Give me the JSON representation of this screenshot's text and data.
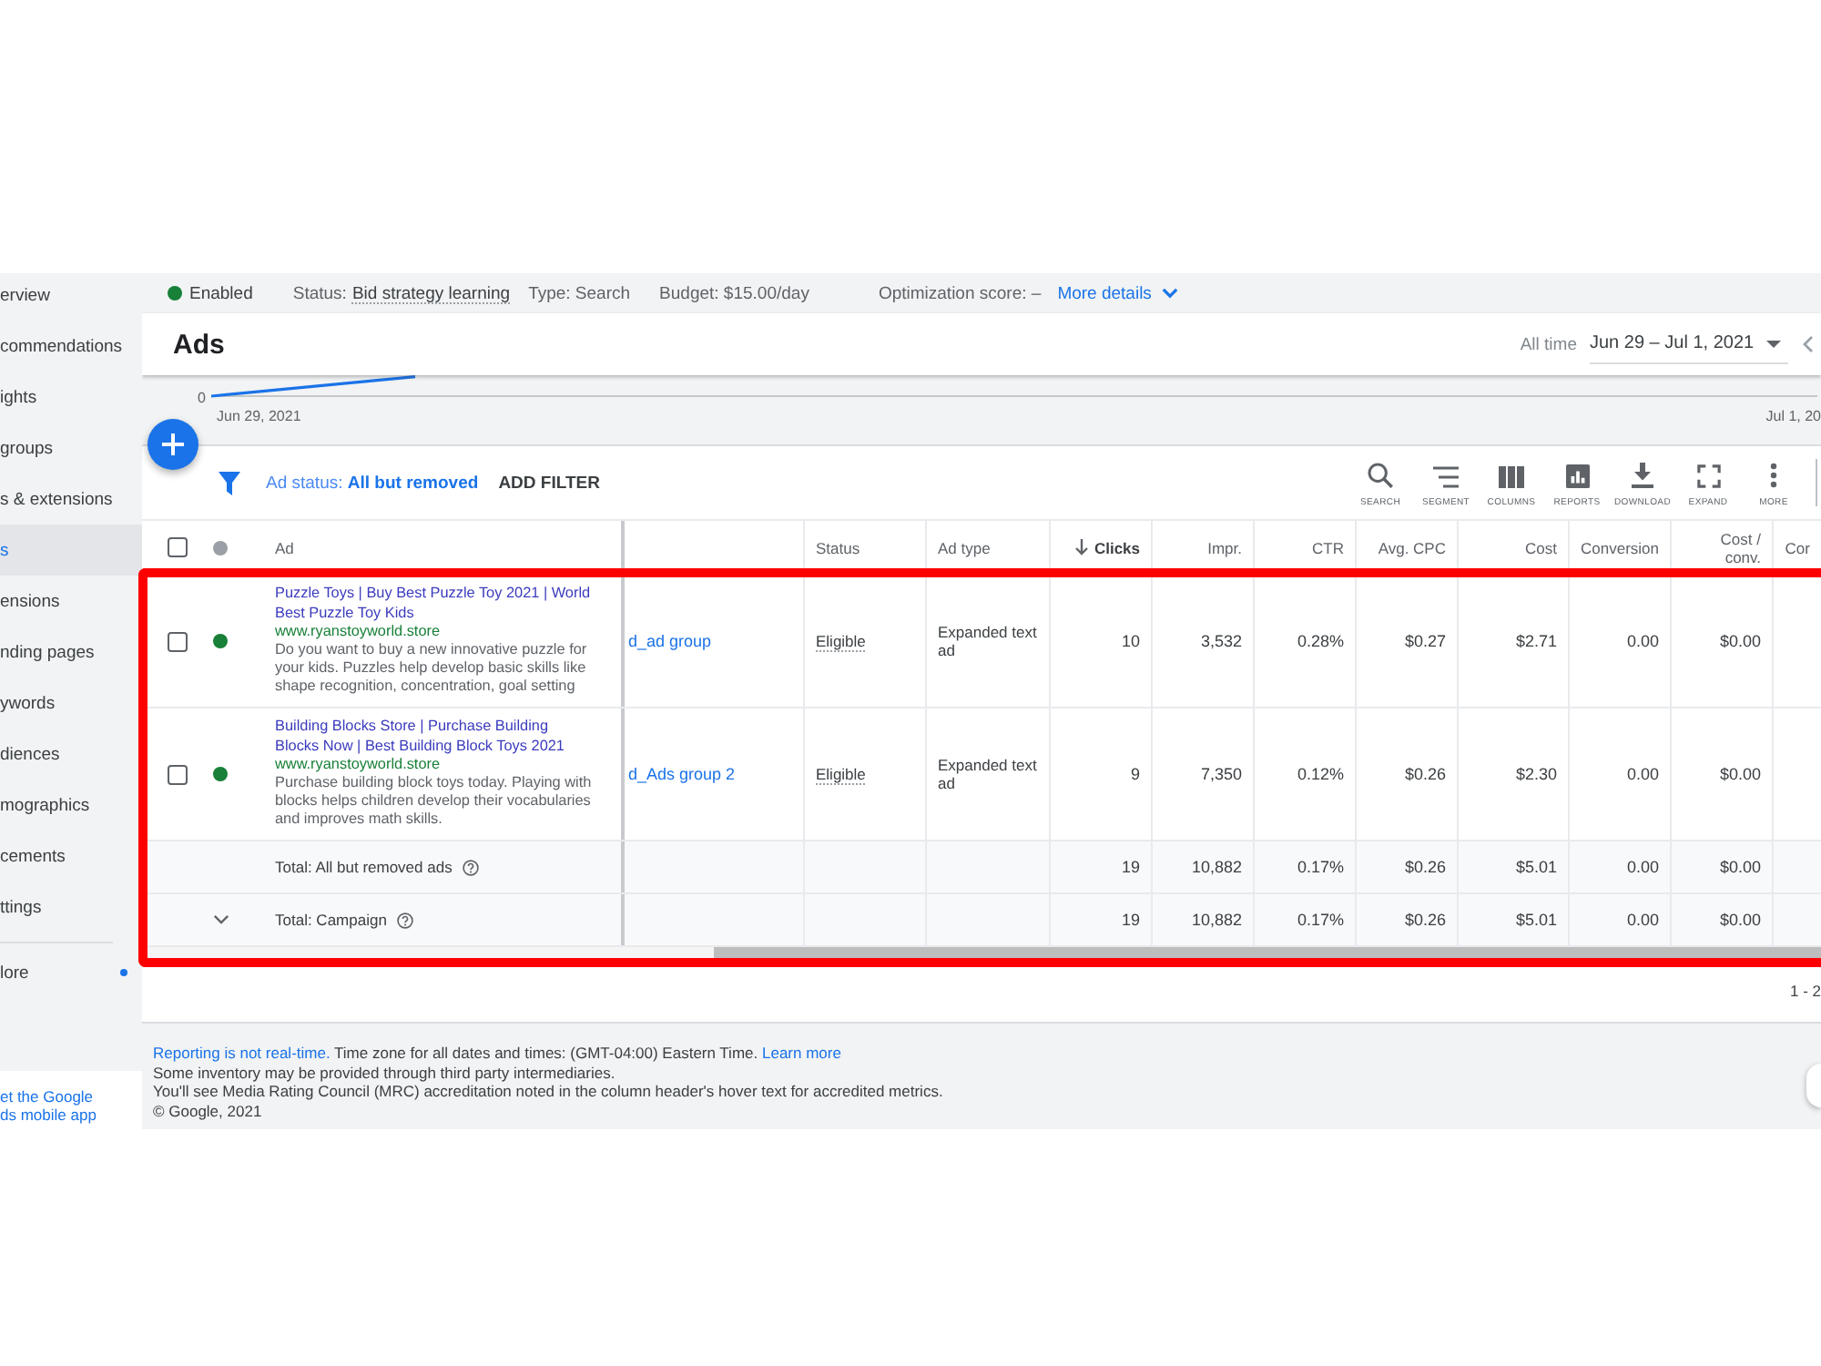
{
  "campaign_summary": {
    "status": "Enabled",
    "status_label": "Status:",
    "bid_status": "Bid strategy learning",
    "type": "Type: Search",
    "budget": "Budget: $15.00/day",
    "optimization": "Optimization score: –",
    "more_details": "More details"
  },
  "sidebar": {
    "items": [
      {
        "label": "erview",
        "selected": false
      },
      {
        "label": "commendations",
        "selected": false
      },
      {
        "label": "ights",
        "selected": false
      },
      {
        "label": "groups",
        "selected": false
      },
      {
        "label": "s & extensions",
        "selected": false
      },
      {
        "label": "s",
        "selected": true
      },
      {
        "label": "ensions",
        "selected": false
      },
      {
        "label": "nding pages",
        "selected": false
      },
      {
        "label": "ywords",
        "selected": false
      },
      {
        "label": "diences",
        "selected": false
      },
      {
        "label": "mographics",
        "selected": false
      },
      {
        "label": "cements",
        "selected": false
      },
      {
        "label": "ttings",
        "selected": false
      }
    ],
    "more": {
      "label": "lore"
    },
    "app_link": "et the Google ds mobile app"
  },
  "header": {
    "title": "Ads",
    "range_label": "All time",
    "date_range": "Jun 29 – Jul 1, 2021"
  },
  "chart": {
    "y_tick": "0",
    "start_date": "Jun 29, 2021",
    "end_date": "Jul 1, 20"
  },
  "filter": {
    "status": "Ad status: **All but removed**",
    "add_filter": "ADD FILTER"
  },
  "toolbar": [
    {
      "kind": "search",
      "label": "SEARCH"
    },
    {
      "kind": "segment",
      "label": "SEGMENT"
    },
    {
      "kind": "columns",
      "label": "COLUMNS"
    },
    {
      "kind": "reports",
      "label": "REPORTS"
    },
    {
      "kind": "download",
      "label": "DOWNLOAD"
    },
    {
      "kind": "expand",
      "label": "EXPAND"
    },
    {
      "kind": "more",
      "label": "MORE"
    }
  ],
  "table": {
    "select_all": {
      "checked": false
    },
    "ad_header": "Ad",
    "columns": [
      {
        "kind": "link"
      },
      {
        "kind": "status",
        "label": "Status"
      },
      {
        "kind": "text",
        "label": "Ad type"
      },
      {
        "kind": "number",
        "label": "Clicks",
        "sorted": true
      },
      {
        "kind": "number",
        "label": "Impr.",
        "sorted": false
      },
      {
        "kind": "number",
        "label": "CTR",
        "sorted": false
      },
      {
        "kind": "number",
        "label": "Avg. CPC",
        "sorted": false
      },
      {
        "kind": "number",
        "label": "Cost",
        "sorted": false
      },
      {
        "kind": "number",
        "label": "Conversion",
        "sorted": false
      },
      {
        "kind": "number",
        "label": "Cost / conv.",
        "sorted": false
      },
      {
        "kind": "number",
        "label": "Cor",
        "sorted": false
      }
    ],
    "rows": [
      {
        "checked": false,
        "color": "#188038",
        "headline": "Puzzle Toys | Buy Best Puzzle Toy 2021 | World Best Puzzle Toy Kids",
        "url": "www.ryanstoyworld.store",
        "description": "Do you want to buy a new innovative puzzle for your kids. Puzzles help develop basic skills like shape recognition, concentration, goal setting",
        "cells": [
          "d_ad group",
          "Eligible",
          "Expanded text ad",
          "10",
          "3,532",
          "0.28%",
          "$0.27",
          "$2.71",
          "0.00",
          "$0.00"
        ]
      },
      {
        "checked": false,
        "color": "#188038",
        "headline": "Building Blocks Store | Purchase Building Blocks Now | Best Building Block Toys 2021",
        "url": "www.ryanstoyworld.store",
        "description": "Purchase building block toys today. Playing with blocks helps children develop their vocabularies and improves math skills.",
        "cells": [
          "d_Ads group 2",
          "Eligible",
          "Expanded text ad",
          "9",
          "7,350",
          "0.12%",
          "$0.26",
          "$2.30",
          "0.00",
          "$0.00"
        ]
      }
    ],
    "totals": [
      {
        "label": "Total: All but removed ads",
        "expandable": false,
        "values": [
          "19",
          "10,882",
          "0.17%",
          "$0.26",
          "$5.01",
          "0.00",
          "$0.00"
        ]
      },
      {
        "label": "Total: Campaign",
        "expandable": true,
        "values": [
          "19",
          "10,882",
          "0.17%",
          "$0.26",
          "$5.01",
          "0.00",
          "$0.00"
        ]
      }
    ]
  },
  "pagination": "1 - 2",
  "footer": {
    "reporting_link": "Reporting is not real-time.",
    "time_zone": "Time zone for all dates and times: (GMT-04:00) Eastern Time.",
    "learn_more": "Learn more",
    "lines": [
      "Some inventory may be provided through third party intermediaries.",
      "You'll see Media Rating Council (MRC) accreditation noted in the column header's hover text for accredited metrics.",
      "© Google, 2021"
    ]
  }
}
